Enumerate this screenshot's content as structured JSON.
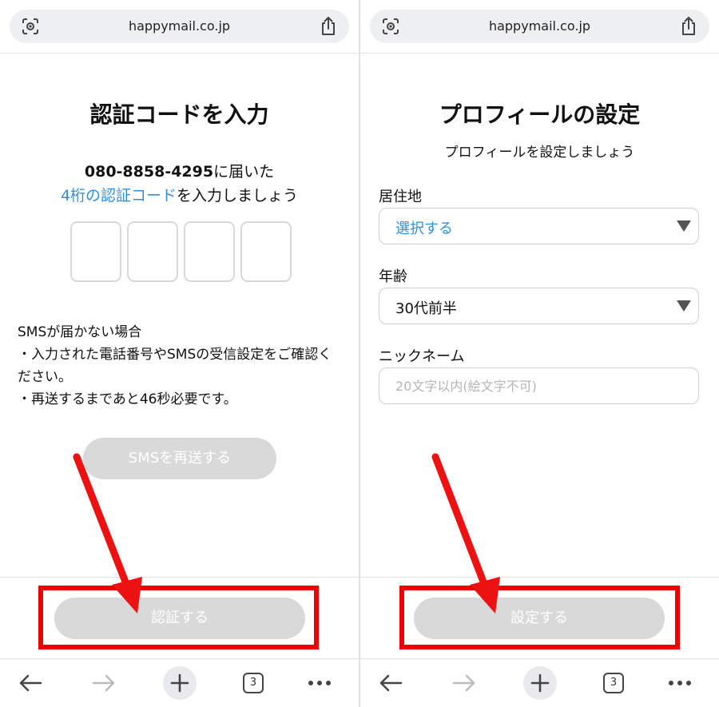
{
  "browser": {
    "url": "happymail.co.jp",
    "tab_count": "3"
  },
  "left": {
    "title": "認証コードを入力",
    "phone_number": "080-8858-4295",
    "phone_suffix": "に届いた",
    "code_link": "4桁の認証コード",
    "code_suffix": "を入力しましょう",
    "notice": [
      "SMSが届かない場合",
      "・入力された電話番号やSMSの受信設定をご確認ください。",
      "・再送するまであと46秒必要です。"
    ],
    "resend_label": "SMSを再送する",
    "confirm_label": "認証する"
  },
  "right": {
    "title": "プロフィールの設定",
    "subtitle": "プロフィールを設定しましょう",
    "residence_label": "居住地",
    "residence_value": "選択する",
    "age_label": "年齢",
    "age_value": "30代前半",
    "nickname_label": "ニックネーム",
    "nickname_placeholder": "20文字以内(絵文字不可)",
    "confirm_label": "設定する"
  },
  "colors": {
    "link": "#2f8fd8",
    "disabled_button": "#d9d9d9",
    "annotation_red": "#ee0000"
  }
}
